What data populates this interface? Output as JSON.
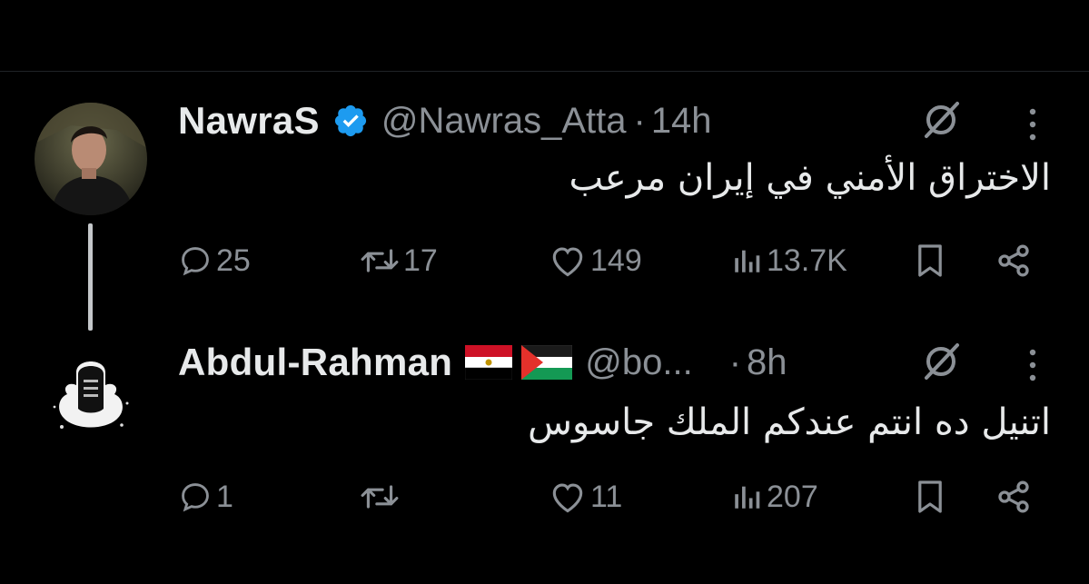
{
  "tweets": [
    {
      "name": "NawraS",
      "handle": "@Nawras_Atta",
      "dot": "·",
      "time": "14h",
      "text": "الاختراق الأمني في إيران مرعب",
      "replies": "25",
      "reposts": "17",
      "likes": "149",
      "views": "13.7K",
      "verified": true
    },
    {
      "name": "Abdul-Rahman",
      "handle": "@bo...",
      "dot": "·",
      "time": "8h",
      "text": "اتنيل ده انتم عندكم الملك جاسوس",
      "replies": "1",
      "reposts": "",
      "likes": "11",
      "views": "207",
      "flags": [
        "egypt-flag",
        "palestine-flag"
      ]
    }
  ],
  "colors": {
    "background": "#000000",
    "text": "#e7e9ea",
    "muted": "#8b9096",
    "verified": "#1d9bf0"
  }
}
